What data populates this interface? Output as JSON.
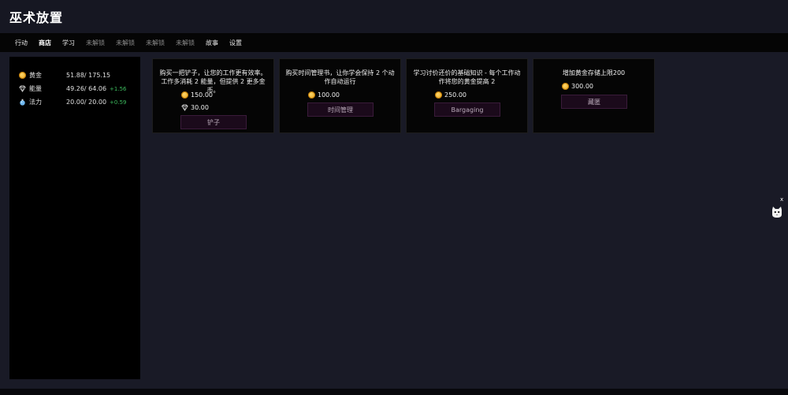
{
  "app": {
    "title": "巫术放置"
  },
  "tabs": [
    {
      "label": "行动",
      "state": "normal"
    },
    {
      "label": "商店",
      "state": "active"
    },
    {
      "label": "学习",
      "state": "normal"
    },
    {
      "label": "未解锁",
      "state": "locked"
    },
    {
      "label": "未解锁",
      "state": "locked"
    },
    {
      "label": "未解锁",
      "state": "locked"
    },
    {
      "label": "未解锁",
      "state": "locked"
    },
    {
      "label": "故事",
      "state": "normal"
    },
    {
      "label": "设置",
      "state": "normal"
    }
  ],
  "resources": [
    {
      "name": "黄金",
      "icon": "gold-coin-icon",
      "value": "51.88/ 175.15",
      "rate": ""
    },
    {
      "name": "能量",
      "icon": "energy-gem-icon",
      "value": "49.26/ 64.06",
      "rate": "+1.56"
    },
    {
      "name": "法力",
      "icon": "mana-potion-icon",
      "value": "20.00/ 20.00",
      "rate": "+0.59"
    }
  ],
  "shop": {
    "cards": [
      {
        "desc": "购买一把铲子，让您的工作更有效率。工作多消耗 2 能量，但提供 2 更多金币。",
        "costs": [
          {
            "icon": "gold-coin-icon",
            "amount": "150.00"
          },
          {
            "icon": "energy-gem-icon",
            "amount": "30.00"
          }
        ],
        "button": "铲子"
      },
      {
        "desc": "购买时间管理书，让你学会保持 2 个动作自动运行",
        "costs": [
          {
            "icon": "gold-coin-icon",
            "amount": "100.00"
          }
        ],
        "button": "时间管理"
      },
      {
        "desc": "学习讨价还价的基础知识 - 每个工作动作将您的黄金提高 2",
        "costs": [
          {
            "icon": "gold-coin-icon",
            "amount": "250.00"
          }
        ],
        "button": "Bargaging"
      },
      {
        "desc": "增加黄金存储上限200",
        "costs": [
          {
            "icon": "gold-coin-icon",
            "amount": "300.00"
          }
        ],
        "button": "藏匿"
      }
    ]
  },
  "floater": {
    "close_label": "x",
    "icon": "cat-mascot-icon"
  },
  "colors": {
    "background": "#191a26",
    "panel": "#000000",
    "rate_positive": "#3cbb5e",
    "button_bg": "#1b0a1b"
  }
}
